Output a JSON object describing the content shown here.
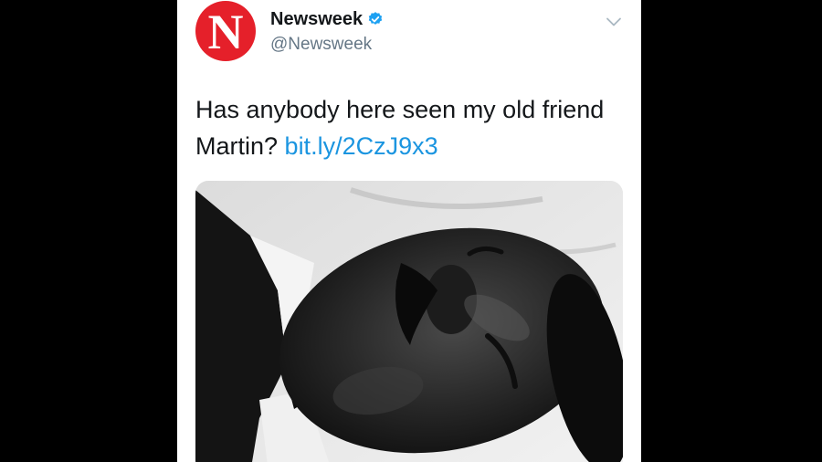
{
  "tweet": {
    "account": {
      "avatar_letter": "N",
      "display_name": "Newsweek",
      "handle": "@Newsweek",
      "verified_icon": "verified-badge-icon",
      "brand_color": "#e5202a"
    },
    "menu_icon": "chevron-down-icon",
    "text": "Has anybody here seen my old friend Martin?",
    "link": "bit.ly/2CzJ9x3",
    "link_color": "#1b95e0",
    "media": {
      "type": "black-and-white photograph"
    }
  }
}
